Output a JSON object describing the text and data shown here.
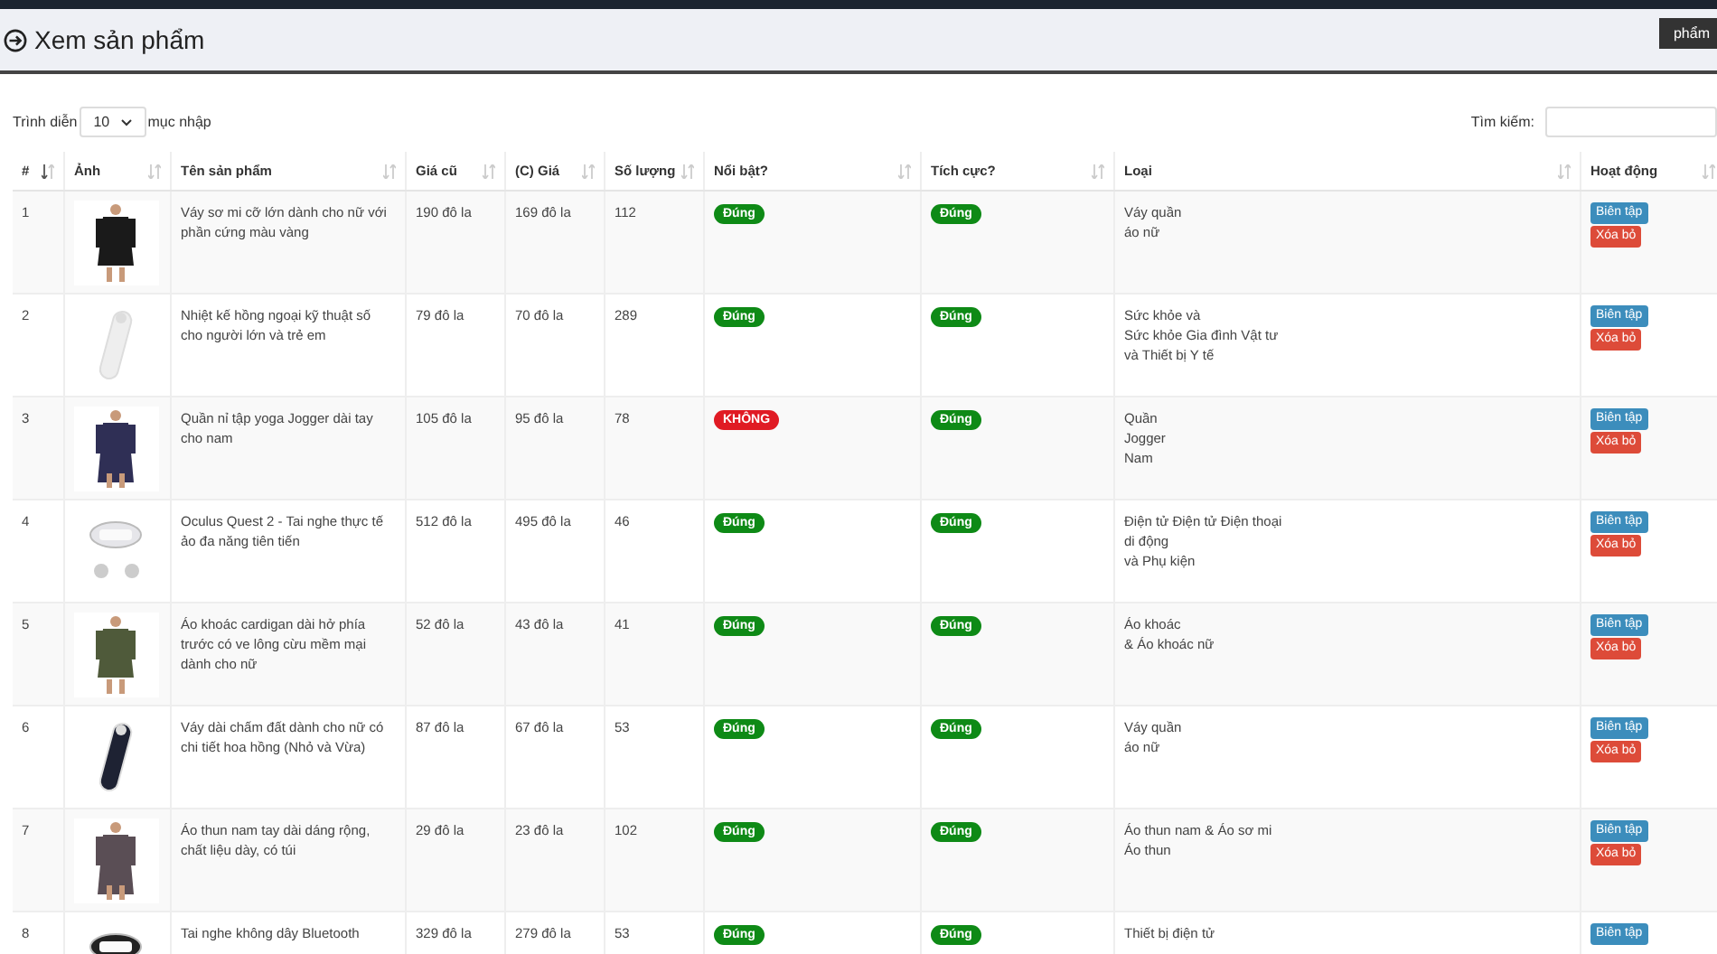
{
  "header": {
    "title": "Xem sản phẩm",
    "add_button": "phẩm"
  },
  "length_control": {
    "prefix": "Trình diễn",
    "value": "10",
    "suffix": "mục nhập"
  },
  "search": {
    "label": "Tìm kiếm:"
  },
  "table": {
    "columns": [
      {
        "label": "#",
        "sorted": true
      },
      {
        "label": "Ảnh",
        "sorted": false
      },
      {
        "label": "Tên sản phẩm",
        "sorted": false
      },
      {
        "label": "Giá cũ",
        "sorted": false
      },
      {
        "label": "(C) Giá",
        "sorted": false
      },
      {
        "label": "Số lượng",
        "sorted": false
      },
      {
        "label": "Nổi bật?",
        "sorted": false
      },
      {
        "label": "Tích cực?",
        "sorted": false
      },
      {
        "label": "Loại",
        "sorted": false
      },
      {
        "label": "Hoạt động",
        "sorted": false
      }
    ],
    "rows": [
      {
        "index": "1",
        "image": {
          "kind": "picture"
        },
        "name": "Váy sơ mi cỡ lớn dành cho nữ với phần cứng màu vàng",
        "old_price": "190 đô la",
        "price": "169 đô la",
        "quantity": "112",
        "featured": {
          "label": "Đúng",
          "value": true
        },
        "active": {
          "label": "Đúng",
          "value": true
        },
        "category": [
          "Váy quần",
          "áo nữ"
        ],
        "actions": [
          "Biên tập",
          "Xóa bỏ"
        ]
      },
      {
        "index": "2",
        "image": {
          "kind": "picture"
        },
        "name": "Nhiệt kế hồng ngoại kỹ thuật số cho người lớn và trẻ em",
        "old_price": "79 đô la",
        "price": "70 đô la",
        "quantity": "289",
        "featured": {
          "label": "Đúng",
          "value": true
        },
        "active": {
          "label": "Đúng",
          "value": true
        },
        "category": [
          "Sức khỏe và",
          "Sức khỏe Gia đình Vật tư",
          "và Thiết bị Y tế"
        ],
        "actions": [
          "Biên tập",
          "Xóa bỏ"
        ]
      },
      {
        "index": "3",
        "image": {
          "kind": "picture"
        },
        "name": "Quần nỉ tập yoga Jogger dài tay cho nam",
        "old_price": "105 đô la",
        "price": "95 đô la",
        "quantity": "78",
        "featured": {
          "label": "KHÔNG",
          "value": false
        },
        "active": {
          "label": "Đúng",
          "value": true
        },
        "category": [
          "Quần",
          "Jogger",
          "Nam"
        ],
        "actions": [
          "Biên tập",
          "Xóa bỏ"
        ]
      },
      {
        "index": "4",
        "image": {
          "kind": "picture"
        },
        "name": "Oculus Quest 2 - Tai nghe thực tế ảo đa năng tiên tiến",
        "old_price": "512 đô la",
        "price": "495 đô la",
        "quantity": "46",
        "featured": {
          "label": "Đúng",
          "value": true
        },
        "active": {
          "label": "Đúng",
          "value": true
        },
        "category": [
          "Điện tử Điện tử Điện thoại",
          "di động",
          "và Phụ kiện"
        ],
        "actions": [
          "Biên tập",
          "Xóa bỏ"
        ]
      },
      {
        "index": "5",
        "image": {
          "kind": "picture"
        },
        "name": "Áo khoác cardigan dài hở phía trước có ve lông cừu mềm mại dành cho nữ",
        "old_price": "52 đô la",
        "price": "43 đô la",
        "quantity": "41",
        "featured": {
          "label": "Đúng",
          "value": true
        },
        "active": {
          "label": "Đúng",
          "value": true
        },
        "category": [
          "Áo khoác",
          "& Áo khoác nữ"
        ],
        "actions": [
          "Biên tập",
          "Xóa bỏ"
        ]
      },
      {
        "index": "6",
        "image": {
          "kind": "picture"
        },
        "name": "Váy dài chấm đất dành cho nữ có chi tiết hoa hồng (Nhỏ và Vừa)",
        "old_price": "87 đô la",
        "price": "67 đô la",
        "quantity": "53",
        "featured": {
          "label": "Đúng",
          "value": true
        },
        "active": {
          "label": "Đúng",
          "value": true
        },
        "category": [
          "Váy quần",
          "áo nữ"
        ],
        "actions": [
          "Biên tập",
          "Xóa bỏ"
        ]
      },
      {
        "index": "7",
        "image": {
          "kind": "picture"
        },
        "name": "Áo thun nam tay dài dáng rộng, chất liệu dày, có túi",
        "old_price": "29 đô la",
        "price": "23 đô la",
        "quantity": "102",
        "featured": {
          "label": "Đúng",
          "value": true
        },
        "active": {
          "label": "Đúng",
          "value": true
        },
        "category": [
          "Áo thun nam & Áo sơ mi",
          "Áo thun"
        ],
        "actions": [
          "Biên tập",
          "Xóa bỏ"
        ]
      },
      {
        "index": "8",
        "image": {
          "kind": "picture"
        },
        "name": "Tai nghe không dây Bluetooth",
        "old_price": "329 đô la",
        "price": "279 đô la",
        "quantity": "53",
        "featured": {
          "label": "Đúng",
          "value": true
        },
        "active": {
          "label": "Đúng",
          "value": true
        },
        "category": [
          "Thiết bị điện tử"
        ],
        "actions": [
          "Biên tập"
        ]
      }
    ]
  }
}
